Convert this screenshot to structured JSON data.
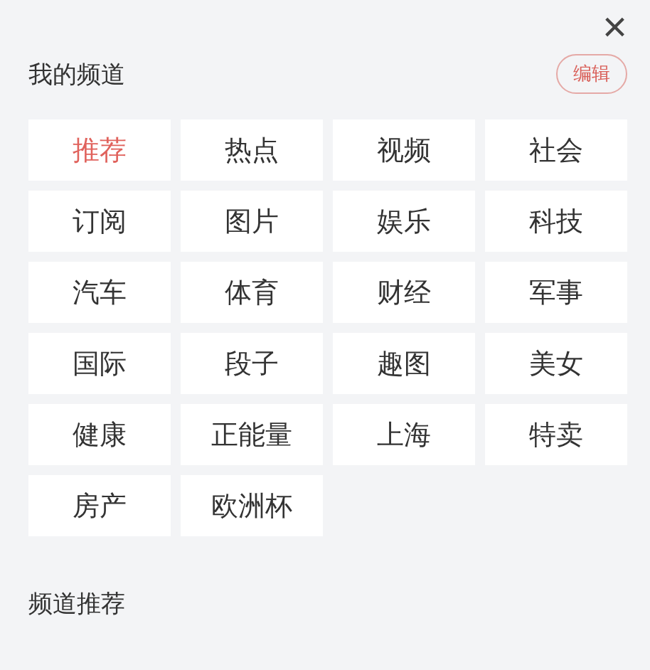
{
  "close": {
    "glyph": "×"
  },
  "my_channels": {
    "title": "我的频道",
    "edit_button": "编辑",
    "items": [
      {
        "label": "推荐",
        "selected": true
      },
      {
        "label": "热点",
        "selected": false
      },
      {
        "label": "视频",
        "selected": false
      },
      {
        "label": "社会",
        "selected": false
      },
      {
        "label": "订阅",
        "selected": false
      },
      {
        "label": "图片",
        "selected": false
      },
      {
        "label": "娱乐",
        "selected": false
      },
      {
        "label": "科技",
        "selected": false
      },
      {
        "label": "汽车",
        "selected": false
      },
      {
        "label": "体育",
        "selected": false
      },
      {
        "label": "财经",
        "selected": false
      },
      {
        "label": "军事",
        "selected": false
      },
      {
        "label": "国际",
        "selected": false
      },
      {
        "label": "段子",
        "selected": false
      },
      {
        "label": "趣图",
        "selected": false
      },
      {
        "label": "美女",
        "selected": false
      },
      {
        "label": "健康",
        "selected": false
      },
      {
        "label": "正能量",
        "selected": false
      },
      {
        "label": "上海",
        "selected": false
      },
      {
        "label": "特卖",
        "selected": false
      },
      {
        "label": "房产",
        "selected": false
      },
      {
        "label": "欧洲杯",
        "selected": false
      }
    ]
  },
  "recommended": {
    "title": "频道推荐"
  }
}
